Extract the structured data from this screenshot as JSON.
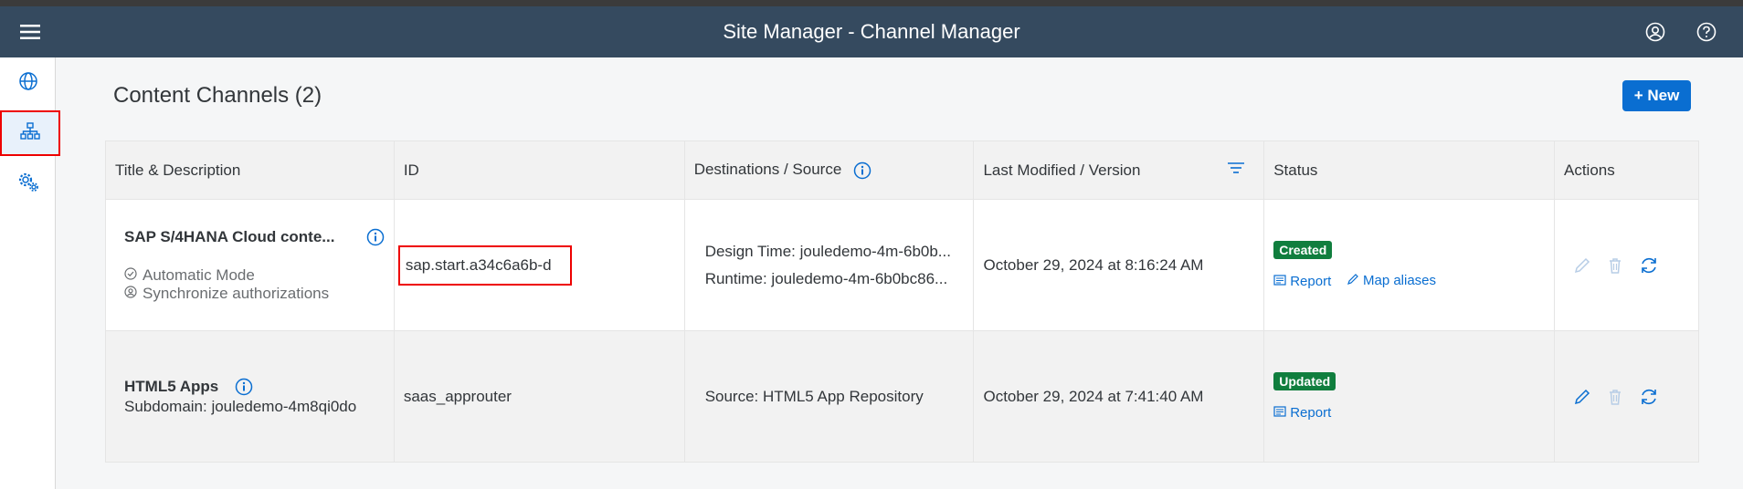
{
  "shell": {
    "title": "Site Manager - Channel Manager"
  },
  "page": {
    "title": "Content Channels (2)",
    "new_label": "+ New"
  },
  "table": {
    "headers": {
      "title": "Title & Description",
      "id": "ID",
      "dest": "Destinations / Source",
      "modified": "Last Modified / Version",
      "status": "Status",
      "actions": "Actions"
    },
    "rows": [
      {
        "name": "SAP S/4HANA Cloud conte...",
        "mode1": "Automatic Mode",
        "mode2": "Synchronize authorizations",
        "id": "sap.start.a34c6a6b-d",
        "dest1": "Design Time: jouledemo-4m-6b0b...",
        "dest2": "Runtime: jouledemo-4m-6b0bc86...",
        "modified": "October 29, 2024 at 8:16:24 AM",
        "status": "Created",
        "report": "Report",
        "map_aliases": "Map aliases"
      },
      {
        "name": "HTML5 Apps",
        "subdomain": "Subdomain: jouledemo-4m8qi0do",
        "id": "saas_approuter",
        "dest1": "Source: HTML5 App Repository",
        "modified": "October 29, 2024 at 7:41:40 AM",
        "status": "Updated",
        "report": "Report"
      }
    ]
  },
  "colors": {
    "shell": "#354a5f",
    "accent": "#0a6ed1",
    "success": "#107e3e",
    "highlight": "#e00000"
  },
  "icons": [
    "menu-icon",
    "user-icon",
    "help-icon",
    "globe-icon",
    "sitemap-icon",
    "settings-icon",
    "info-icon",
    "filter-icon",
    "edit-icon",
    "delete-icon",
    "refresh-icon",
    "report-icon",
    "pencil-icon"
  ]
}
